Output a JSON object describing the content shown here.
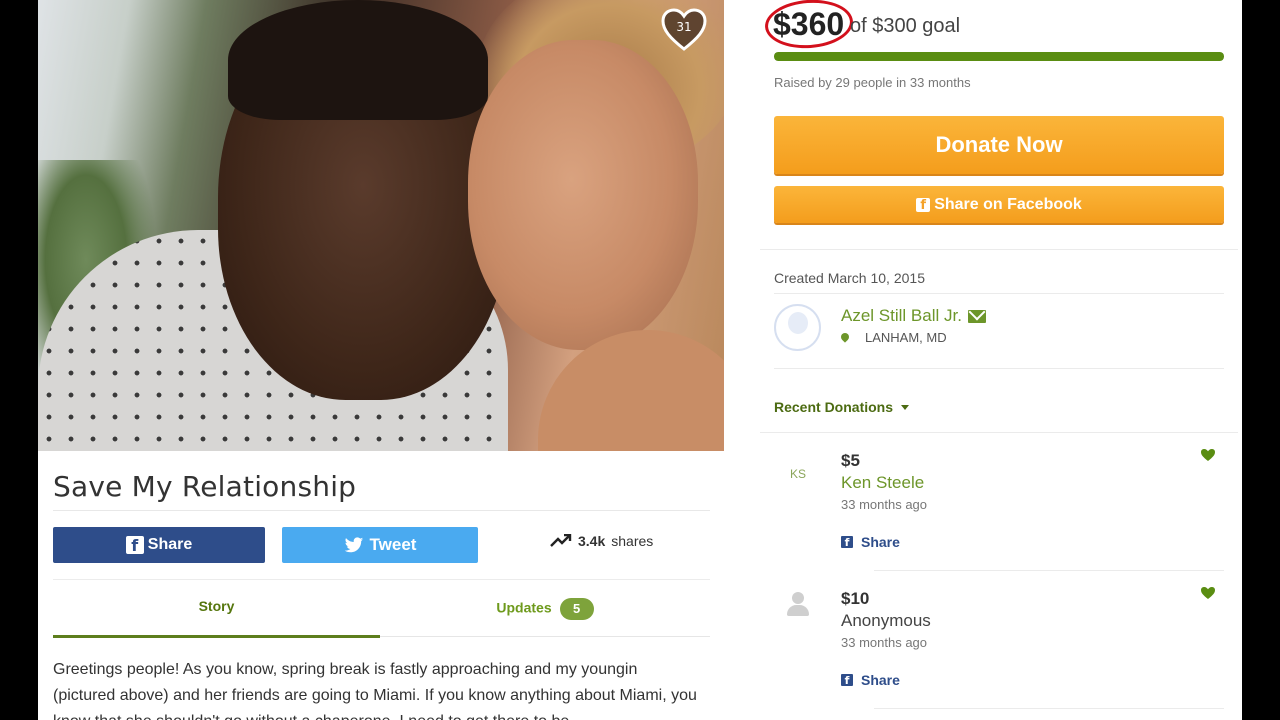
{
  "hero": {
    "heart_count": "31"
  },
  "campaign": {
    "title": "Save My Relationship",
    "story": "Greetings people! As you know, spring break is fastly approaching and my youngin (pictured above) and  her friends are going to Miami. If you know anything about Miami, you know that she shouldn't go without a chaperone. I need to get there to be"
  },
  "social": {
    "share_label": "Share",
    "tweet_label": "Tweet",
    "shares_count": "3.4k",
    "shares_label": "shares"
  },
  "tabs": {
    "story_label": "Story",
    "updates_label": "Updates",
    "updates_count": "5"
  },
  "funding": {
    "amount": "$360",
    "goal_text": "of $300 goal",
    "progress_fraction": 1.0,
    "raised_text": "Raised by 29 people in 33 months"
  },
  "actions": {
    "donate_label": "Donate Now",
    "fb_share_label": "Share on Facebook"
  },
  "organizer": {
    "created_text": "Created March 10, 2015",
    "name": "Azel Still Ball Jr.",
    "location": "LANHAM, MD"
  },
  "recent_donations": {
    "heading": "Recent Donations",
    "items": [
      {
        "initials": "KS",
        "amount": "$5",
        "name": "Ken Steele",
        "time": "33 months ago",
        "share_label": "Share"
      },
      {
        "initials": "",
        "amount": "$10",
        "name": "Anonymous",
        "time": "33 months ago",
        "share_label": "Share"
      }
    ]
  },
  "colors": {
    "accent_green": "#5a8d12",
    "donate_orange": "#f49d1c",
    "facebook_blue": "#2e4d8a",
    "twitter_blue": "#4aaaf0",
    "highlight_red": "#d3101c"
  }
}
